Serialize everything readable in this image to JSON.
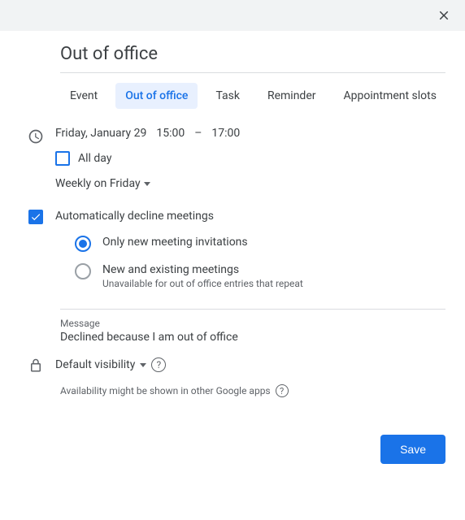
{
  "header": {
    "title": "Out of office"
  },
  "tabs": [
    {
      "label": "Event",
      "active": false
    },
    {
      "label": "Out of office",
      "active": true
    },
    {
      "label": "Task",
      "active": false
    },
    {
      "label": "Reminder",
      "active": false
    },
    {
      "label": "Appointment slots",
      "active": false
    }
  ],
  "datetime": {
    "date": "Friday, January 29",
    "start": "15:00",
    "sep": "–",
    "end": "17:00"
  },
  "allday": {
    "label": "All day",
    "checked": false
  },
  "recurrence": {
    "label": "Weekly on Friday"
  },
  "autoDecline": {
    "checked": true,
    "label": "Automatically decline meetings",
    "options": [
      {
        "label": "Only new meeting invitations",
        "sub": "",
        "selected": true
      },
      {
        "label": "New and existing meetings",
        "sub": "Unavailable for out of office entries that repeat",
        "selected": false
      }
    ]
  },
  "message": {
    "label": "Message",
    "value": "Declined because I am out of office"
  },
  "visibility": {
    "label": "Default visibility"
  },
  "info": {
    "text": "Availability might be shown in other Google apps"
  },
  "footer": {
    "save": "Save"
  }
}
